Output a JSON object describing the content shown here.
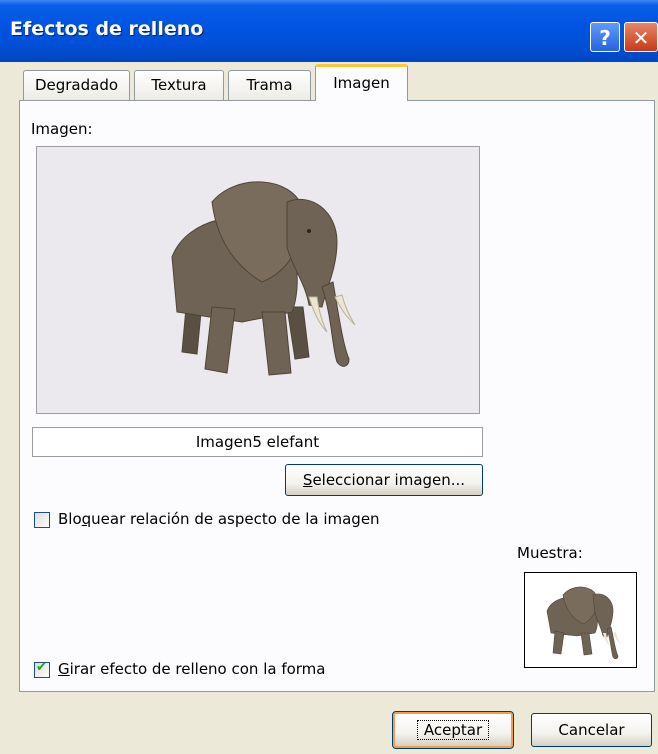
{
  "window": {
    "title": "Efectos de relleno",
    "help_glyph": "?",
    "close_glyph": "✕"
  },
  "tabs": [
    {
      "label": "Degradado",
      "active": false
    },
    {
      "label": "Textura",
      "active": false
    },
    {
      "label": "Trama",
      "active": false
    },
    {
      "label": "Imagen",
      "active": true
    }
  ],
  "image_section": {
    "label": "Imagen:",
    "preview_icon": "elephant-image",
    "file_name": "Imagen5 elefant",
    "select_button": {
      "prefix": "",
      "mnemonic": "S",
      "rest": "eleccionar imagen..."
    }
  },
  "lock_aspect": {
    "checked": false,
    "prefix": "Blo",
    "mnemonic": "q",
    "rest": "uear relación de aspecto de la imagen"
  },
  "sample": {
    "label": "Muestra:",
    "icon": "elephant-thumbnail"
  },
  "rotate_fill": {
    "checked": true,
    "check_glyph": "✔",
    "prefix": "",
    "mnemonic": "G",
    "rest": "irar efecto de relleno con la forma"
  },
  "buttons": {
    "ok": "Aceptar",
    "cancel": "Cancelar"
  },
  "colors": {
    "titlebar": "#0054e3",
    "dialog_bg": "#ece9d8",
    "tab_highlight": "#ffc83c",
    "ok_focus": "#f59e4a",
    "check_green": "#21a121"
  }
}
